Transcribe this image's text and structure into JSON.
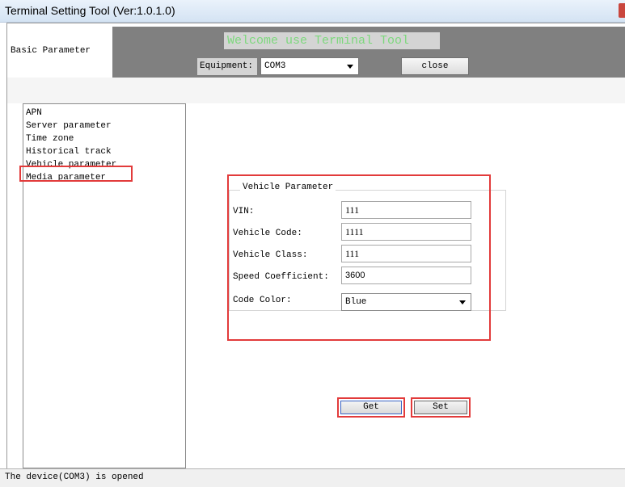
{
  "window": {
    "title": "Terminal Setting Tool (Ver:1.0.1.0)"
  },
  "tabs": {
    "basic": "Basic Parameter"
  },
  "header": {
    "welcome": "Welcome use Terminal Tool",
    "equipment_label": "Equipment:",
    "equipment_value": "COM3",
    "close_label": "close"
  },
  "sidebar": {
    "items": [
      {
        "label": "APN"
      },
      {
        "label": "Server parameter"
      },
      {
        "label": "Time zone"
      },
      {
        "label": "Historical track"
      },
      {
        "label": "Vehicle parameter",
        "selected": true
      },
      {
        "label": "Media parameter"
      }
    ]
  },
  "vehicle": {
    "group_title": "Vehicle Parameter",
    "vin_label": "VIN:",
    "vin_value": "111",
    "code_label": "Vehicle Code:",
    "code_value": "1111",
    "class_label": "Vehicle Class:",
    "class_value": "111",
    "speed_label": "Speed Coefficient:",
    "speed_value": "3600",
    "color_label": "Code Color:",
    "color_value": "Blue"
  },
  "actions": {
    "get_label": "Get",
    "set_label": "Set"
  },
  "status": {
    "text": "The device(COM3) is opened"
  },
  "colors": {
    "highlight": "#e23b3b",
    "header_gray": "#808080",
    "welcome_text": "#7dd87d",
    "titlebar": "#dbe7f5"
  }
}
